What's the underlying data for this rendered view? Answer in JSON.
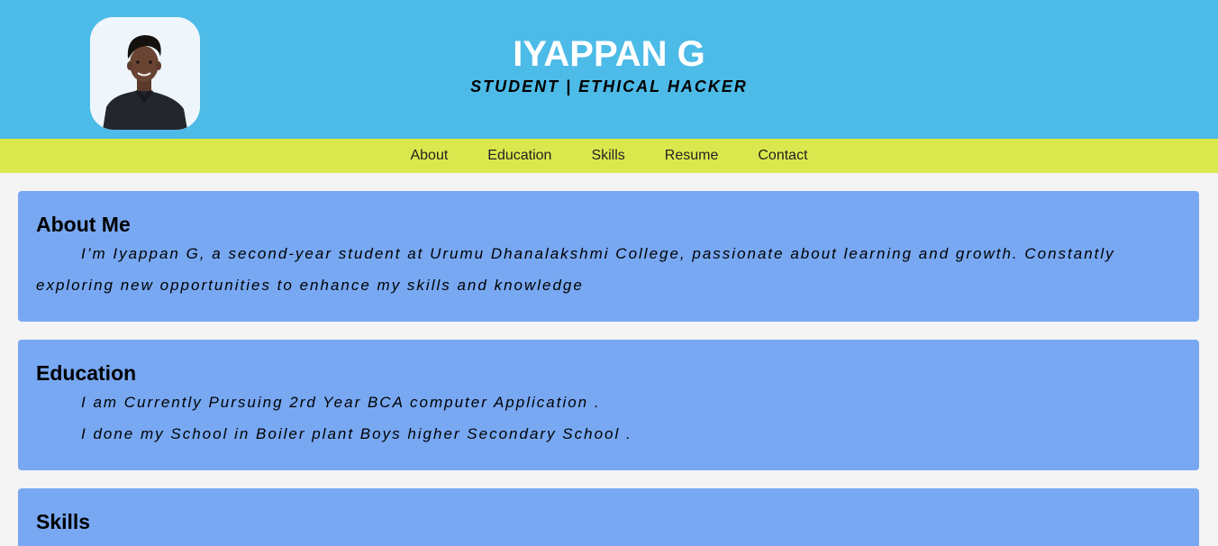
{
  "header": {
    "name": "IYAPPAN G",
    "tagline": "STUDENT | ETHICAL HACKER",
    "background_color": "#4dbbe8",
    "avatar_icon": "profile-photo"
  },
  "nav": {
    "background_color": "#dbe84d",
    "items": [
      {
        "label": "About"
      },
      {
        "label": "Education"
      },
      {
        "label": "Skills"
      },
      {
        "label": "Resume"
      },
      {
        "label": "Contact"
      }
    ]
  },
  "sections": {
    "about": {
      "title": "About Me",
      "text": "I’m Iyappan G, a second-year student at Urumu Dhanalakshmi College, passionate about learning and growth. Constantly exploring new opportunities to enhance my skills and knowledge"
    },
    "education": {
      "title": "Education",
      "lines": [
        "I am Currently Pursuing 2rd Year BCA computer Application .",
        "I done my School in Boiler plant Boys higher Secondary School ."
      ]
    },
    "skills": {
      "title": "Skills"
    }
  },
  "colors": {
    "card": "#78a8f2",
    "page_bg": "#f4f4f4"
  }
}
